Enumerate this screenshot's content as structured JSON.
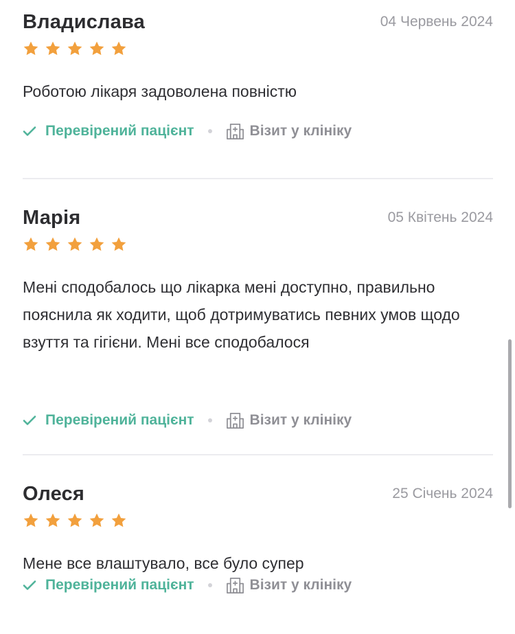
{
  "reviews": [
    {
      "name": "Владислава",
      "date": "04 Червень 2024",
      "rating": 5,
      "text": "Роботою лікаря задоволена повністю",
      "verified_label": "Перевірений пацієнт",
      "visit_label": "Візит у клініку"
    },
    {
      "name": "Марія",
      "date": "05 Квітень 2024",
      "rating": 5,
      "text": "Мені сподобалось що лікарка мені доступно, правильно пояснила як ходити, щоб дотримуватись певних умов щодо взуття та гігієни. Мені все сподобалося",
      "verified_label": "Перевірений пацієнт",
      "visit_label": "Візит у клініку"
    },
    {
      "name": "Олеся",
      "date": "25 Січень 2024",
      "rating": 5,
      "text": "Мене все влаштувало, все було супер",
      "verified_label": "Перевірений пацієнт",
      "visit_label": "Візит у клініку"
    }
  ],
  "colors": {
    "star": "#f2a03d",
    "verified": "#4fb39a",
    "muted": "#8f8f95",
    "divider": "#ececef"
  },
  "icons": {
    "star": "star-icon",
    "verified": "check-icon",
    "visit": "hospital-icon"
  }
}
